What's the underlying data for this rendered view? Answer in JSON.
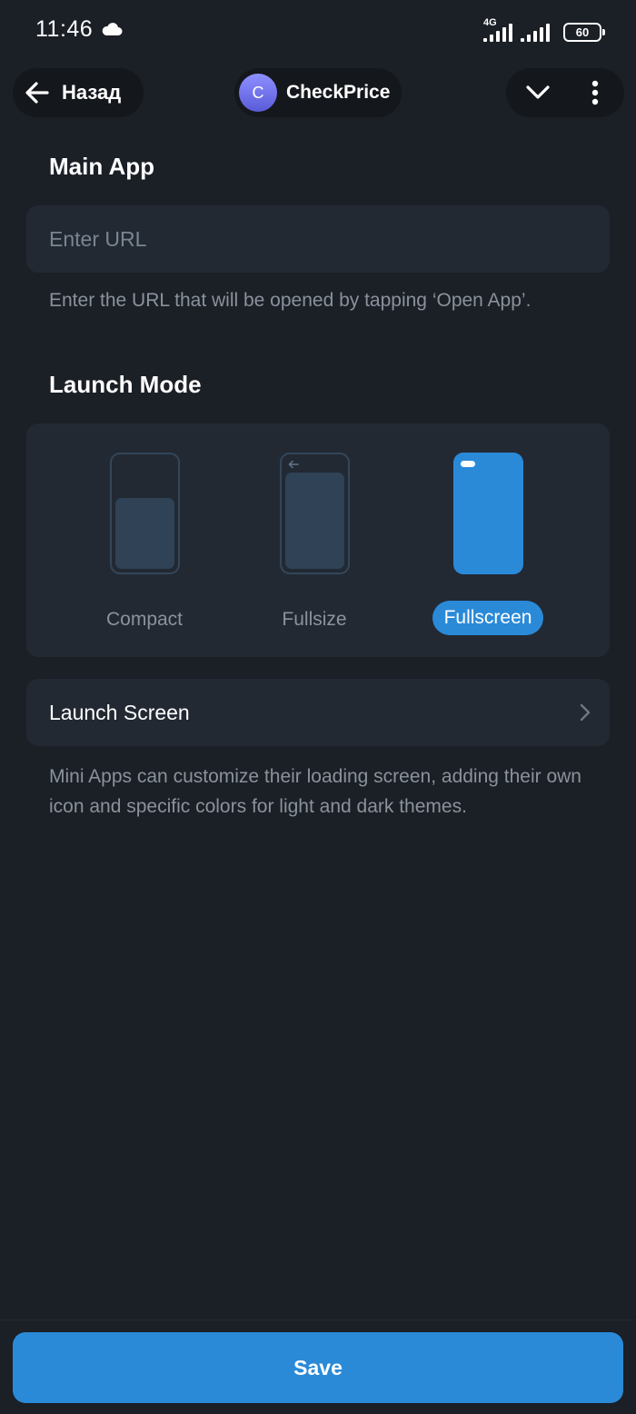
{
  "status_bar": {
    "time": "11:46",
    "network": "4G",
    "battery": "60",
    "icons": [
      "cloud-icon",
      "signal-icon",
      "battery-icon"
    ]
  },
  "header": {
    "back_label": "Назад",
    "avatar_letter": "C",
    "app_title": "CheckPrice",
    "icons": [
      "arrow-left-icon",
      "chevron-down-icon",
      "more-vertical-icon"
    ]
  },
  "main_app": {
    "title": "Main App",
    "url_value": "",
    "url_placeholder": "Enter URL",
    "hint": "Enter the URL that will be opened by tapping ‘Open App’."
  },
  "launch_mode": {
    "title": "Launch Mode",
    "options": [
      {
        "label": "Compact",
        "selected": false
      },
      {
        "label": "Fullsize",
        "selected": false
      },
      {
        "label": "Fullscreen",
        "selected": true
      }
    ]
  },
  "launch_screen": {
    "label": "Launch Screen",
    "hint": "Mini Apps can customize their loading screen, adding their own icon and specific colors for light and dark themes."
  },
  "footer": {
    "save_label": "Save"
  },
  "colors": {
    "background": "#1b1f26",
    "card": "#222933",
    "accent": "#2a8ad8",
    "hint_text": "#8a929c"
  }
}
